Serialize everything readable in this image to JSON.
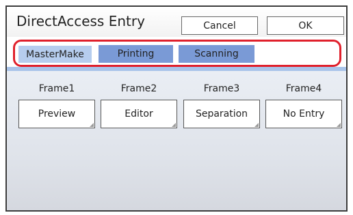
{
  "header": {
    "title": "DirectAccess Entry",
    "cancel_label": "Cancel",
    "ok_label": "OK"
  },
  "tabs": [
    {
      "label": "MasterMake",
      "active": true
    },
    {
      "label": "Printing",
      "active": false
    },
    {
      "label": "Scanning",
      "active": false
    }
  ],
  "frames": [
    {
      "label": "Frame1",
      "value": "Preview"
    },
    {
      "label": "Frame2",
      "value": "Editor"
    },
    {
      "label": "Frame3",
      "value": "Separation"
    },
    {
      "label": "Frame4",
      "value": "No Entry"
    }
  ],
  "colors": {
    "highlight": "#e0202c",
    "active_tab": "#b6cdee",
    "inactive_tab": "#7a9ad6"
  }
}
